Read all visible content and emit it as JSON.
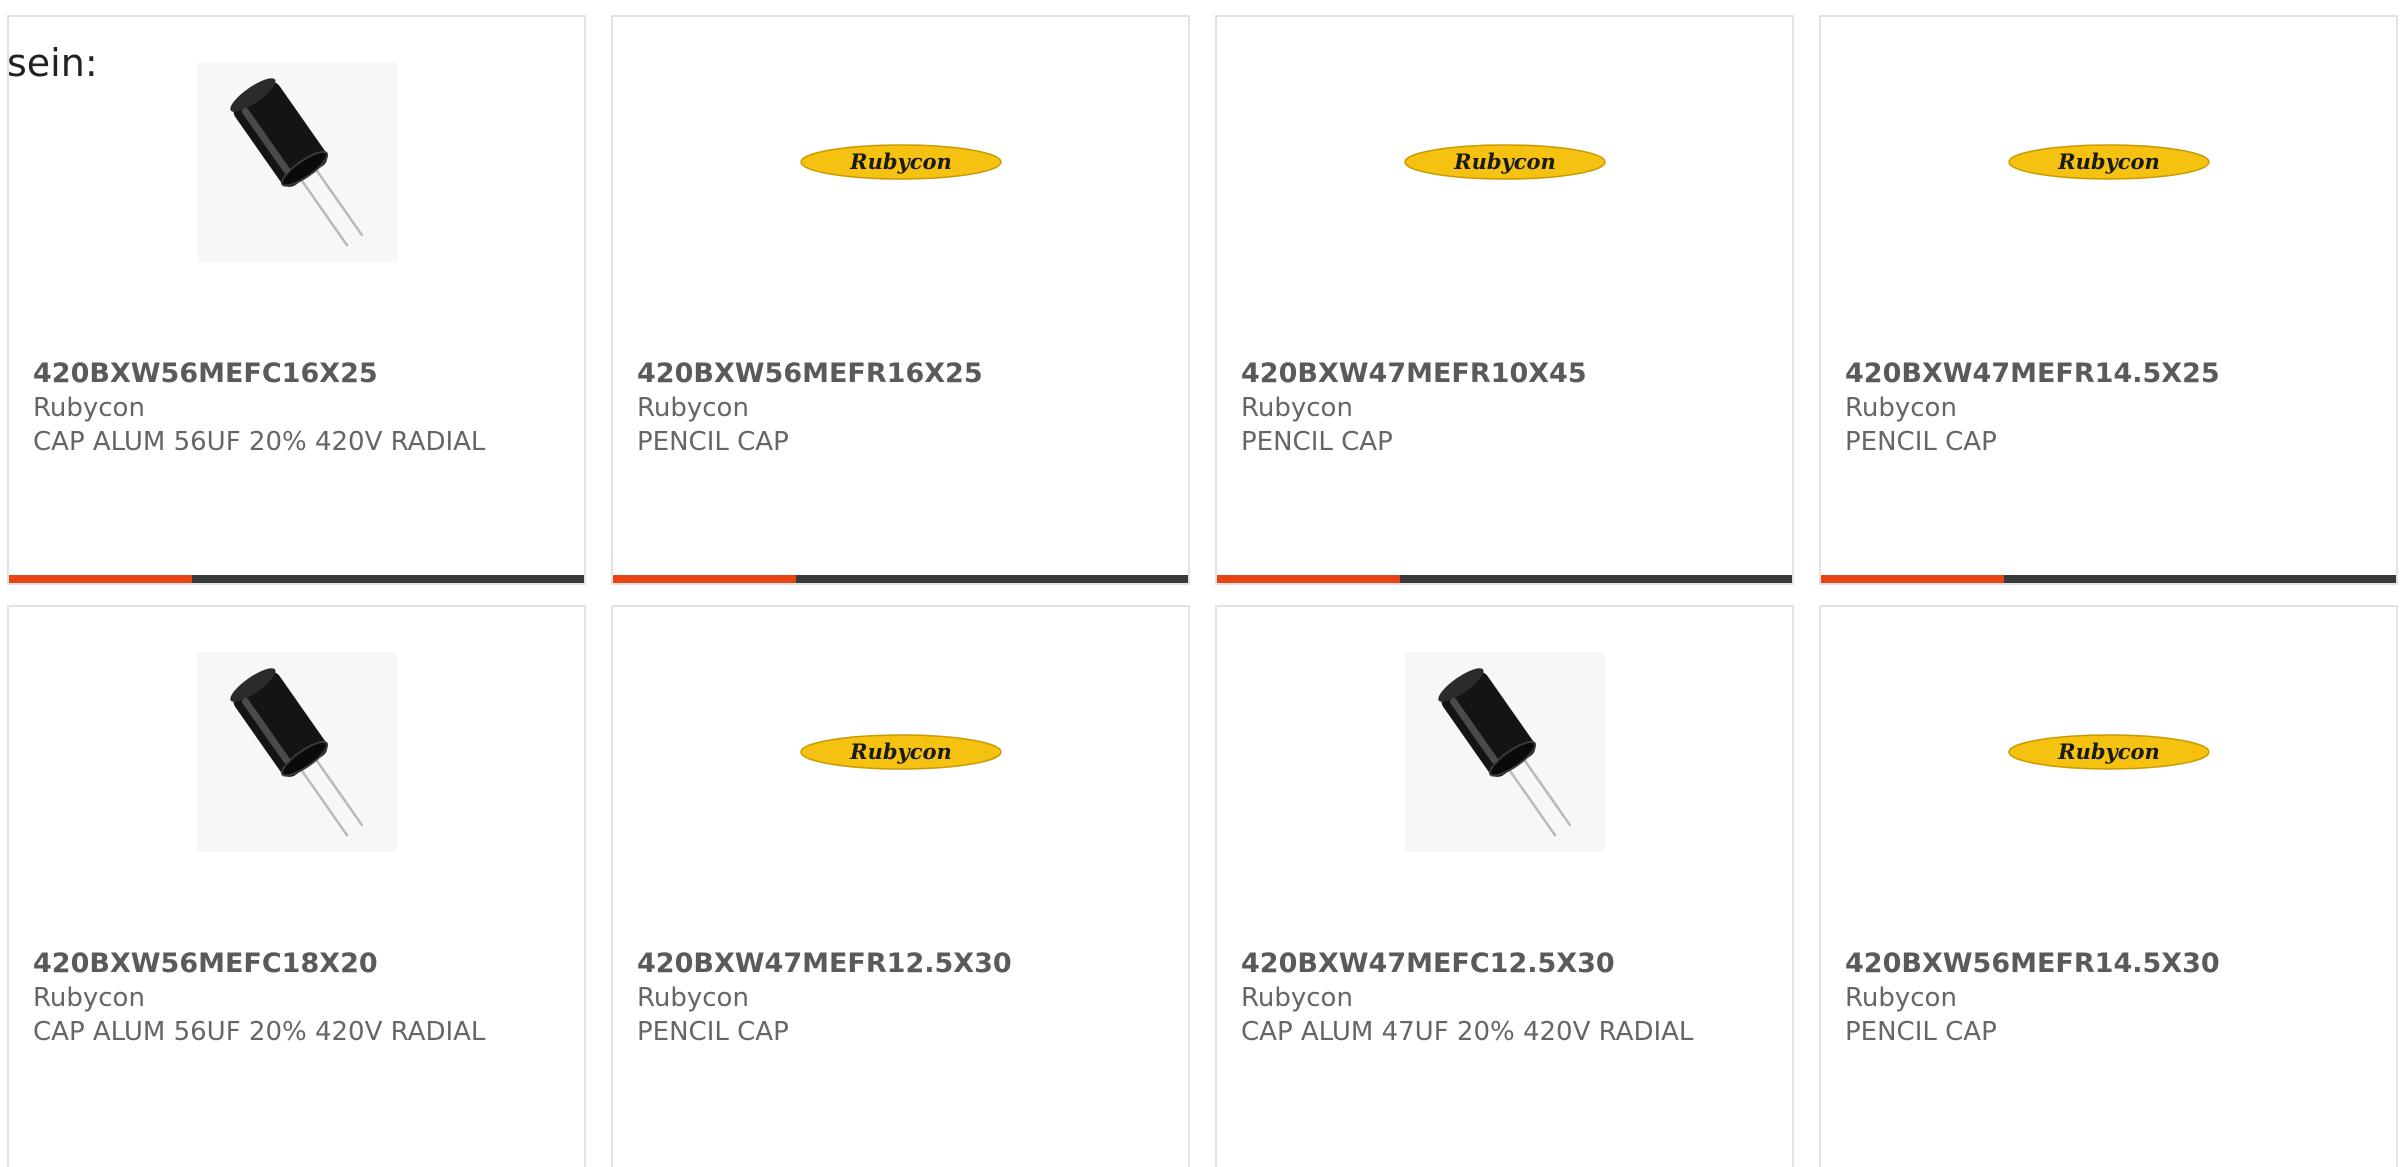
{
  "heading_fragment": "sein:",
  "colors": {
    "card_border": "#e2e2e2",
    "text_gray": "#666666",
    "bar_dark": "#3a3a3a",
    "bar_accent": "#e84312",
    "logo_yellow": "#f5c211"
  },
  "products": [
    {
      "part": "420BXW56MEFC16X25",
      "manufacturer": "Rubycon",
      "description": "CAP ALUM 56UF 20% 420V RADIAL",
      "image": "capacitor-photo",
      "logo_text": ""
    },
    {
      "part": "420BXW56MEFR16X25",
      "manufacturer": "Rubycon",
      "description": "PENCIL CAP",
      "image": "rubycon-logo",
      "logo_text": "Rubycon"
    },
    {
      "part": "420BXW47MEFR10X45",
      "manufacturer": "Rubycon",
      "description": "PENCIL CAP",
      "image": "rubycon-logo",
      "logo_text": "Rubycon"
    },
    {
      "part": "420BXW47MEFR14.5X25",
      "manufacturer": "Rubycon",
      "description": "PENCIL CAP",
      "image": "rubycon-logo",
      "logo_text": "Rubycon"
    },
    {
      "part": "420BXW56MEFC18X20",
      "manufacturer": "Rubycon",
      "description": "CAP ALUM 56UF 20% 420V RADIAL",
      "image": "capacitor-photo",
      "logo_text": ""
    },
    {
      "part": "420BXW47MEFR12.5X30",
      "manufacturer": "Rubycon",
      "description": "PENCIL CAP",
      "image": "rubycon-logo",
      "logo_text": "Rubycon"
    },
    {
      "part": "420BXW47MEFC12.5X30",
      "manufacturer": "Rubycon",
      "description": "CAP ALUM 47UF 20% 420V RADIAL",
      "image": "capacitor-photo",
      "logo_text": ""
    },
    {
      "part": "420BXW56MEFR14.5X30",
      "manufacturer": "Rubycon",
      "description": "PENCIL CAP",
      "image": "rubycon-logo",
      "logo_text": "Rubycon"
    }
  ]
}
